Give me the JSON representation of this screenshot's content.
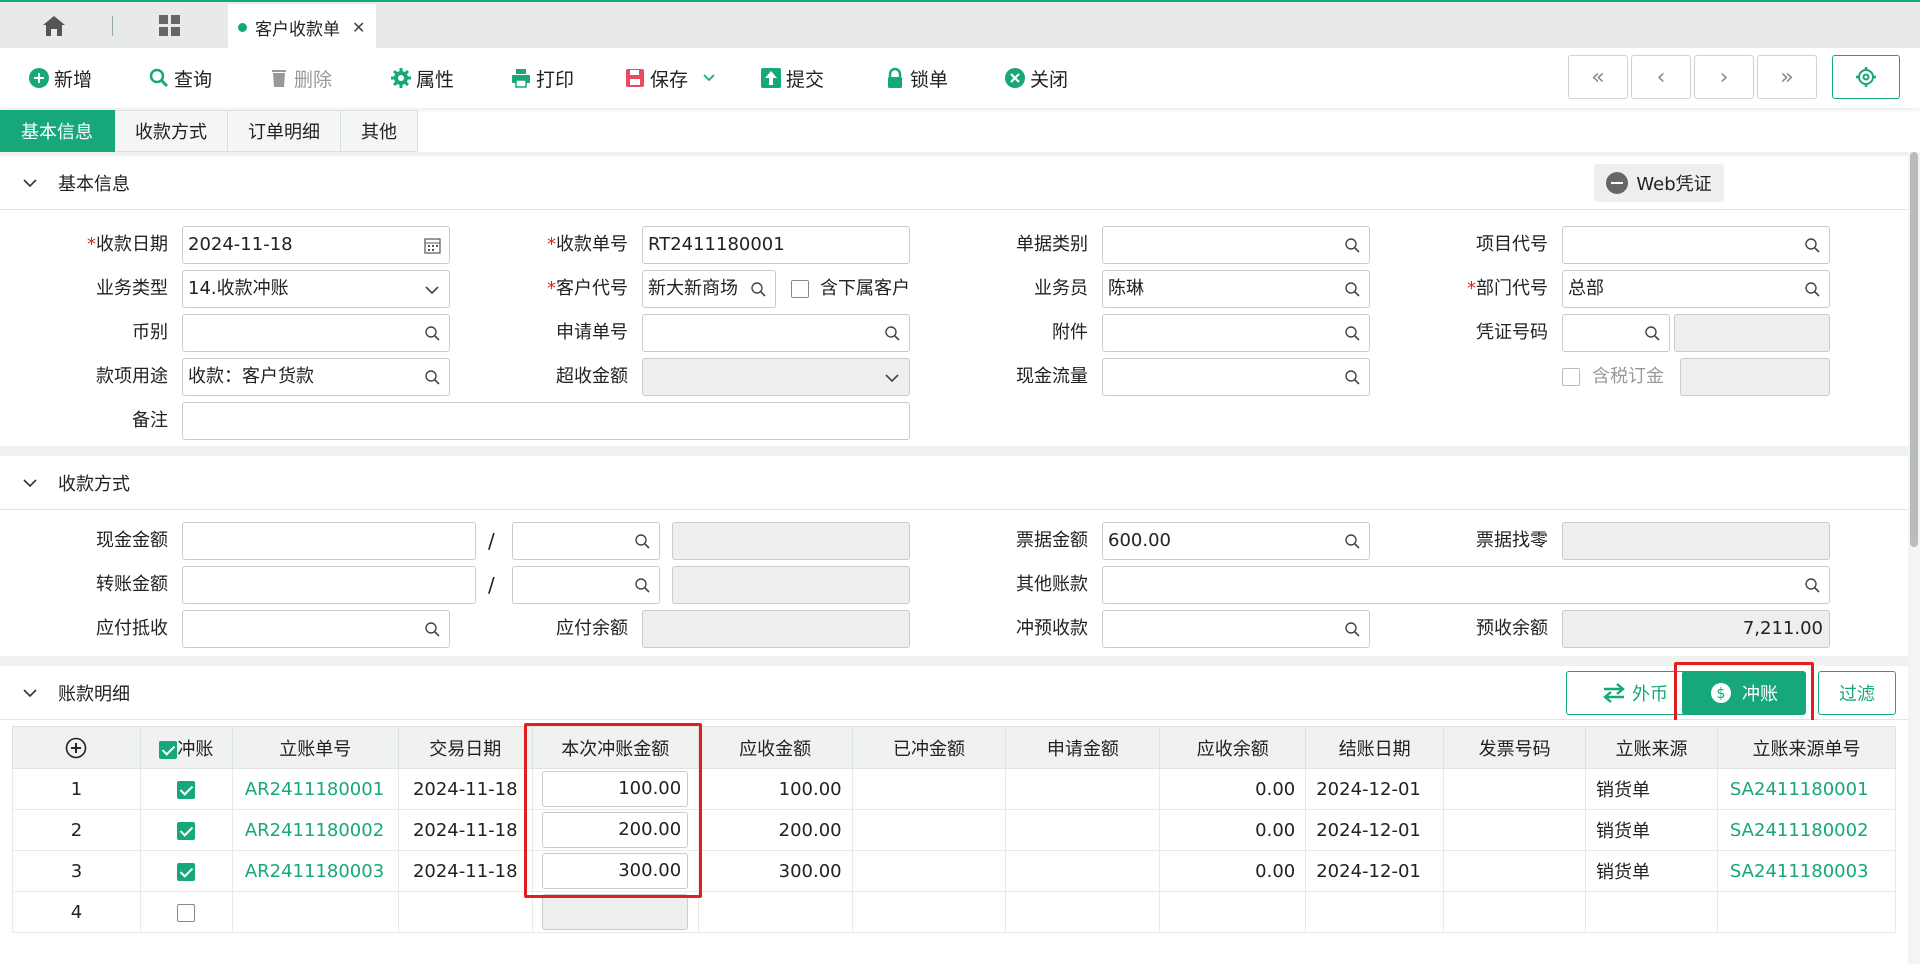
{
  "top_tabs": {
    "doc_tab": "客户收款单"
  },
  "toolbar": {
    "new": "新增",
    "query": "查询",
    "delete": "删除",
    "properties": "属性",
    "print": "打印",
    "save": "保存",
    "submit": "提交",
    "lock": "锁单",
    "close": "关闭",
    "nav_first": "«",
    "nav_prev": "‹",
    "nav_next": "›",
    "nav_last": "»"
  },
  "section_tabs": [
    "基本信息",
    "收款方式",
    "订单明细",
    "其他"
  ],
  "basic": {
    "title": "基本信息",
    "web_voucher": "Web凭证",
    "receipt_date_label": "收款日期",
    "receipt_date": "2024-11-18",
    "receipt_no_label": "收款单号",
    "receipt_no": "RT2411180001",
    "doc_type_label": "单据类别",
    "doc_type": "",
    "project_code_label": "项目代号",
    "project_code": "",
    "biz_type_label": "业务类型",
    "biz_type": "14.收款冲账",
    "customer_code_label": "客户代号",
    "customer_code": "新大新商场",
    "include_sub_label": "含下属客户",
    "salesperson_label": "业务员",
    "salesperson": "陈琳",
    "dept_code_label": "部门代号",
    "dept_code": "总部",
    "currency_label": "币别",
    "currency": "",
    "request_no_label": "申请单号",
    "request_no": "",
    "attachment_label": "附件",
    "attachment": "",
    "voucher_no_label": "凭证号码",
    "voucher_no": "",
    "purpose_label": "款项用途",
    "purpose": "收款：客户货款",
    "over_amount_label": "超收金额",
    "over_amount": "",
    "cash_flow_label": "现金流量",
    "cash_flow": "",
    "tax_deposit_label": "含税订金",
    "remark_label": "备注",
    "remark": ""
  },
  "payment": {
    "title": "收款方式",
    "cash_label": "现金金额",
    "transfer_label": "转账金额",
    "payable_offset_label": "应付抵收",
    "payable_balance_label": "应付余额",
    "bill_amount_label": "票据金额",
    "bill_amount": "600.00",
    "other_account_label": "其他账款",
    "prepay_offset_label": "冲预收款",
    "bill_change_label": "票据找零",
    "prepay_balance_label": "预收余额",
    "prepay_balance": "7,211.00",
    "slash": "/"
  },
  "ledger": {
    "title": "账款明细",
    "btn_foreign": "外币",
    "btn_offset": "冲账",
    "btn_filter": "过滤",
    "columns": [
      "冲账",
      "立账单号",
      "交易日期",
      "本次冲账金额",
      "应收金额",
      "已冲金额",
      "申请金额",
      "应收余额",
      "结账日期",
      "发票号码",
      "立账来源",
      "立账来源单号"
    ],
    "rows": [
      {
        "n": "1",
        "checked": true,
        "ar_no": "AR2411180001",
        "date": "2024-11-18",
        "offset": "100.00",
        "receivable": "100.00",
        "offset_done": "",
        "request": "",
        "balance": "0.00",
        "settle_date": "2024-12-01",
        "invoice": "",
        "source": "销货单",
        "source_no": "SA2411180001"
      },
      {
        "n": "2",
        "checked": true,
        "ar_no": "AR2411180002",
        "date": "2024-11-18",
        "offset": "200.00",
        "receivable": "200.00",
        "offset_done": "",
        "request": "",
        "balance": "0.00",
        "settle_date": "2024-12-01",
        "invoice": "",
        "source": "销货单",
        "source_no": "SA2411180002"
      },
      {
        "n": "3",
        "checked": true,
        "ar_no": "AR2411180003",
        "date": "2024-11-18",
        "offset": "300.00",
        "receivable": "300.00",
        "offset_done": "",
        "request": "",
        "balance": "0.00",
        "settle_date": "2024-12-01",
        "invoice": "",
        "source": "销货单",
        "source_no": "SA2411180003"
      },
      {
        "n": "4",
        "checked": false,
        "ar_no": "",
        "date": "",
        "offset": "",
        "receivable": "",
        "offset_done": "",
        "request": "",
        "balance": "",
        "settle_date": "",
        "invoice": "",
        "source": "",
        "source_no": ""
      }
    ]
  },
  "colors": {
    "accent": "#16a77a",
    "highlight": "#e02020"
  }
}
